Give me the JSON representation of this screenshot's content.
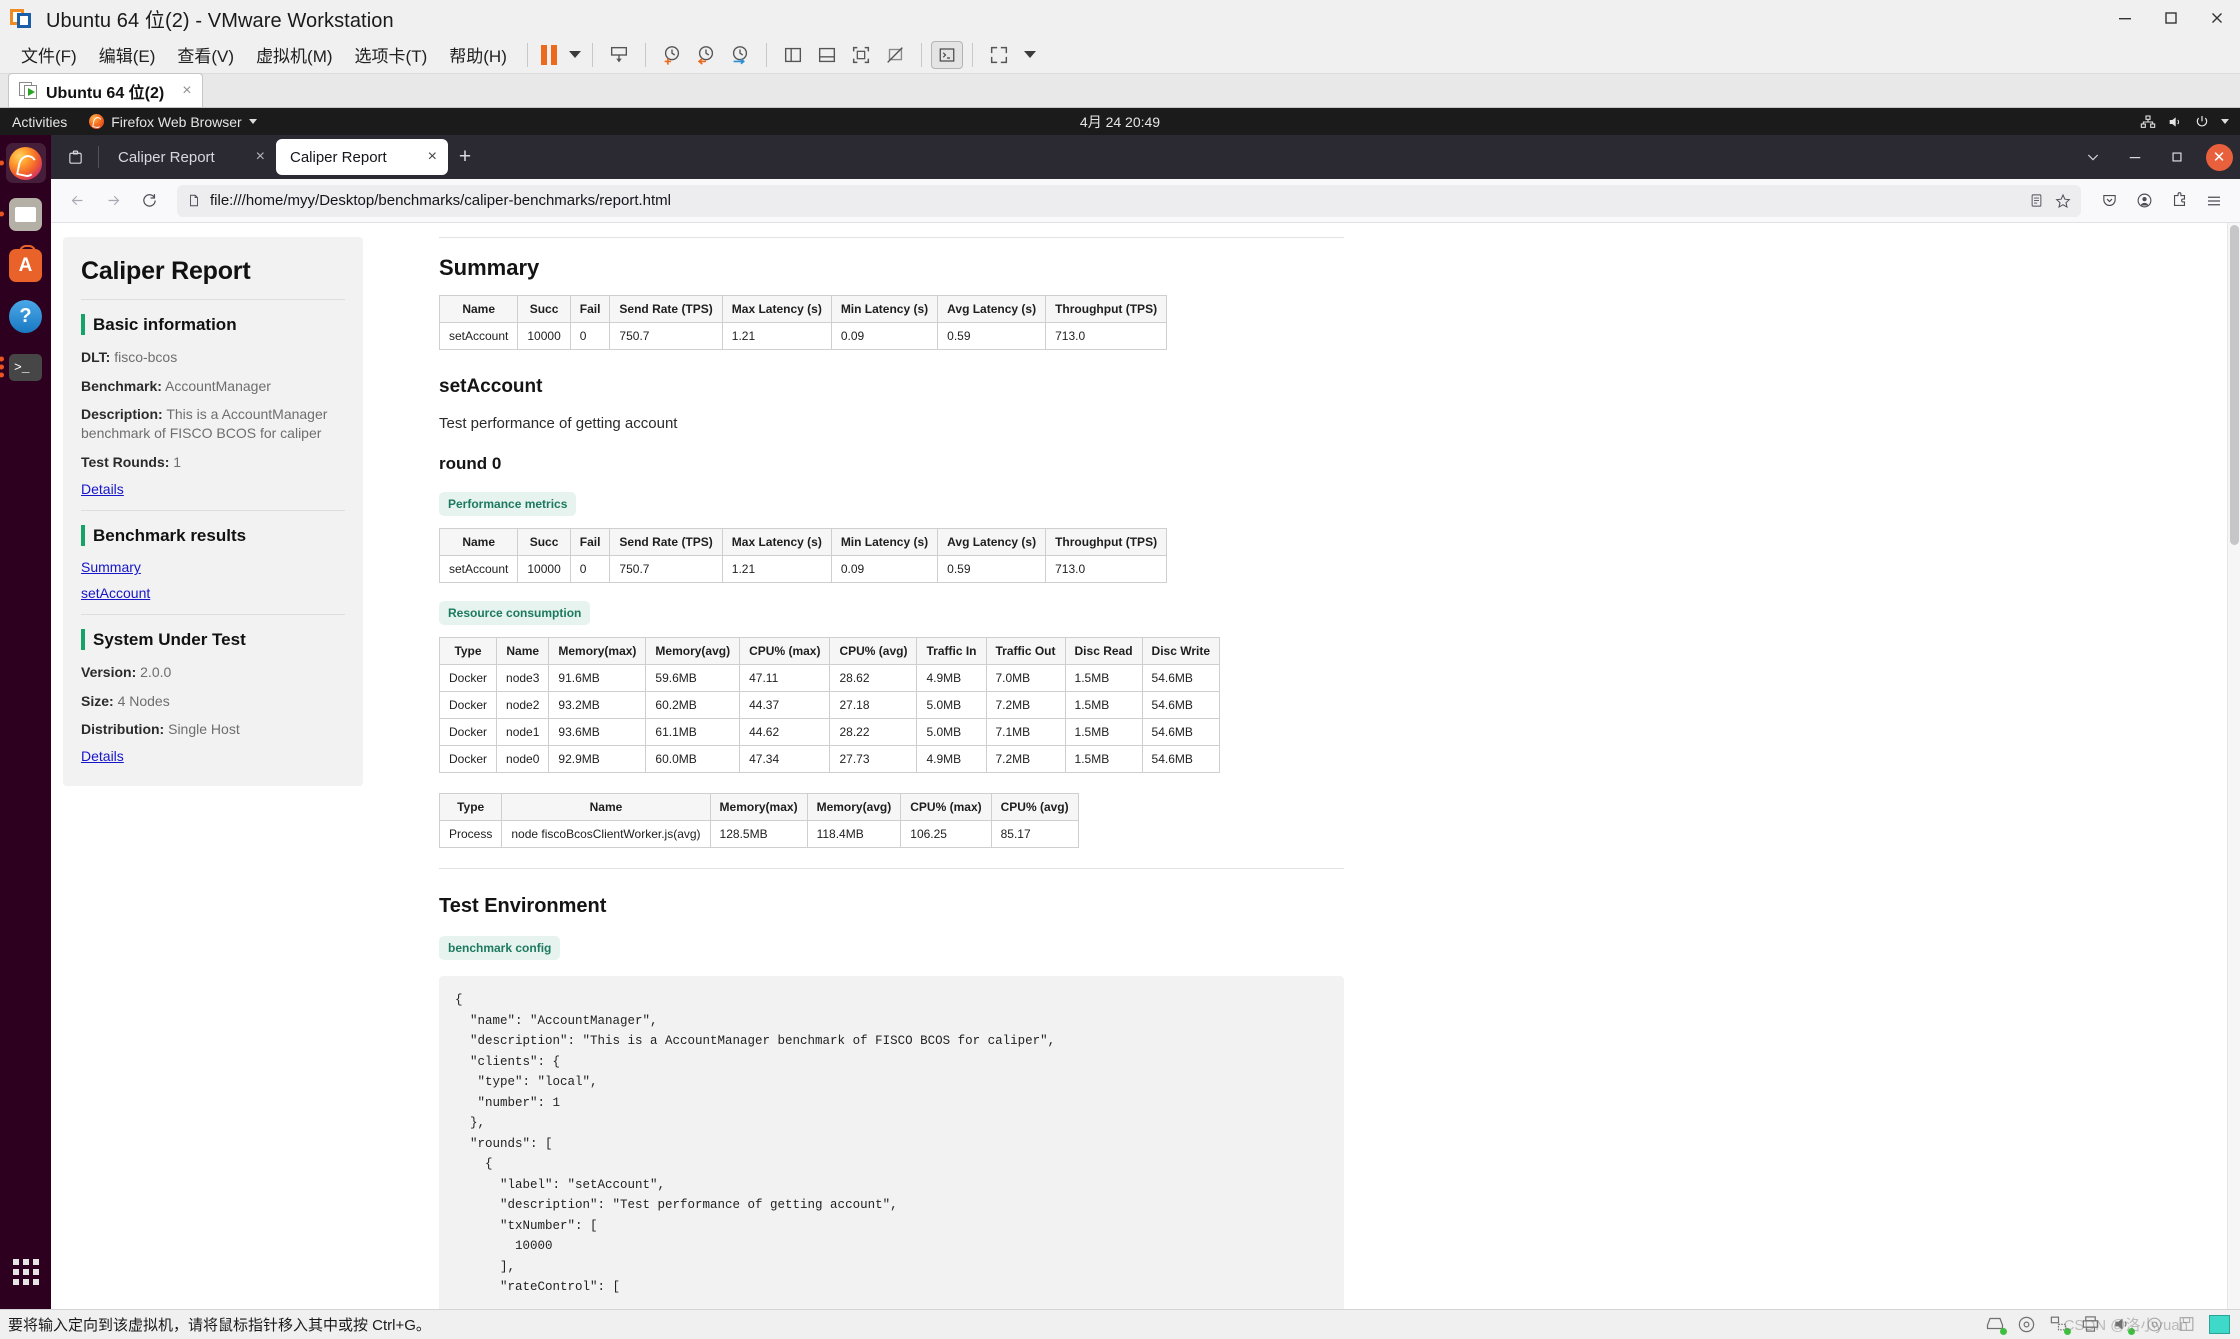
{
  "vmware": {
    "window_title": "Ubuntu 64 位(2) - VMware Workstation",
    "logo_icon": "vmware-logo-icon",
    "menus": [
      {
        "label": "文件(F)",
        "name": "menu-file"
      },
      {
        "label": "编辑(E)",
        "name": "menu-edit"
      },
      {
        "label": "查看(V)",
        "name": "menu-view"
      },
      {
        "label": "虚拟机(M)",
        "name": "menu-vm"
      },
      {
        "label": "选项卡(T)",
        "name": "menu-tabs"
      },
      {
        "label": "帮助(H)",
        "name": "menu-help"
      }
    ],
    "toolbar": [
      {
        "name": "suspend-button",
        "icon": "pause-icon"
      },
      {
        "name": "power-dropdown",
        "icon": "chevron-down-icon"
      },
      {
        "name": "send-ctrl-alt-del-button",
        "icon": "keyboard-send-icon"
      },
      {
        "name": "take-snapshot-button",
        "icon": "snapshot-add-icon"
      },
      {
        "name": "revert-snapshot-button",
        "icon": "snapshot-revert-icon"
      },
      {
        "name": "snapshot-manager-button",
        "icon": "snapshot-manager-icon"
      },
      {
        "name": "show-library-button",
        "icon": "panel-left-icon"
      },
      {
        "name": "show-thumbnail-bar-button",
        "icon": "panel-bottom-icon"
      },
      {
        "name": "full-screen-button",
        "icon": "fullscreen-icon"
      },
      {
        "name": "unity-mode-button",
        "icon": "unity-mode-icon"
      },
      {
        "name": "console-view-button",
        "icon": "terminal-icon"
      },
      {
        "name": "stretch-view-button",
        "icon": "stretch-icon"
      },
      {
        "name": "stretch-view-dropdown",
        "icon": "chevron-down-icon"
      }
    ],
    "vm_tab": {
      "label": "Ubuntu 64 位(2)",
      "icon": "vm-running-icon",
      "close": "×"
    },
    "window_controls": {
      "minimize": "minimize-icon",
      "maximize": "maximize-icon",
      "close": "close-icon"
    },
    "statusbar": {
      "message": "要将输入定向到该虚拟机，请将鼠标指针移入其中或按 Ctrl+G。",
      "devices": [
        "hard-disk-icon",
        "cd-dvd-icon",
        "network-adapter-icon",
        "printer-icon",
        "sound-card-icon",
        "usb-icon",
        "floppy-icon",
        "display-icon"
      ],
      "watermark": "CSDN @洛小yuan"
    }
  },
  "ubuntu": {
    "topbar": {
      "activities": "Activities",
      "app_name": "Firefox Web Browser",
      "app_icon": "firefox-icon",
      "clock": "4月 24  20:49",
      "system_icons": [
        "network-icon",
        "volume-icon",
        "power-icon",
        "chevron-down-icon"
      ]
    },
    "dock": [
      {
        "name": "dock-item-firefox",
        "icon": "firefox-icon",
        "running": true,
        "active": true
      },
      {
        "name": "dock-item-files",
        "icon": "files-icon",
        "running": true,
        "active": false
      },
      {
        "name": "dock-item-software",
        "icon": "ubuntu-software-icon",
        "running": false,
        "active": false
      },
      {
        "name": "dock-item-help",
        "icon": "help-icon",
        "running": false,
        "active": false
      },
      {
        "name": "dock-item-terminal",
        "icon": "terminal-icon",
        "running": true,
        "active": false
      }
    ],
    "show_apps": "show-applications-icon"
  },
  "firefox": {
    "list_all_tabs_icon": "list-all-tabs-icon",
    "tabs": [
      {
        "title": "Caliper Report",
        "selected": false,
        "close": "×"
      },
      {
        "title": "Caliper Report",
        "selected": true,
        "close": "×"
      }
    ],
    "new_tab": "+",
    "window_controls": {
      "minimize": "−",
      "restore": "▫",
      "close": "×"
    },
    "nav": {
      "back_icon": "arrow-left-icon",
      "forward_icon": "arrow-right-icon",
      "reload_icon": "reload-icon",
      "page_icon": "document-icon",
      "url": "file:///home/myy/Desktop/benchmarks/caliper-benchmarks/report.html",
      "reader_icon": "reader-mode-icon",
      "bookmark_icon": "star-icon"
    },
    "toolbar_right": [
      "pocket-icon",
      "account-icon",
      "extensions-icon",
      "hamburger-menu-icon"
    ]
  },
  "report": {
    "sidebar": {
      "title": "Caliper Report",
      "sections": [
        {
          "heading": "Basic information",
          "fields": [
            {
              "key": "DLT:",
              "value": "fisco-bcos"
            },
            {
              "key": "Benchmark:",
              "value": "AccountManager"
            },
            {
              "key": "Description:",
              "value": "This is a AccountManager benchmark of FISCO BCOS for caliper"
            },
            {
              "key": "Test Rounds:",
              "value": "1"
            }
          ],
          "link": "Details"
        },
        {
          "heading": "Benchmark results",
          "links": [
            "Summary",
            "setAccount"
          ]
        },
        {
          "heading": "System Under Test",
          "fields": [
            {
              "key": "Version:",
              "value": "2.0.0"
            },
            {
              "key": "Size:",
              "value": "4 Nodes"
            },
            {
              "key": "Distribution:",
              "value": "Single Host"
            }
          ],
          "link": "Details"
        }
      ]
    },
    "main": {
      "summary_heading": "Summary",
      "round_name": "setAccount",
      "round_description": "Test performance of getting account",
      "round_heading": "round 0",
      "pill_performance": "Performance metrics",
      "pill_resource": "Resource consumption",
      "env_heading": "Test Environment",
      "pill_config": "benchmark config",
      "perf_columns": [
        "Name",
        "Succ",
        "Fail",
        "Send Rate (TPS)",
        "Max Latency (s)",
        "Min Latency (s)",
        "Avg Latency (s)",
        "Throughput (TPS)"
      ],
      "summary_rows": [
        [
          "setAccount",
          "10000",
          "0",
          "750.7",
          "1.21",
          "0.09",
          "0.59",
          "713.0"
        ]
      ],
      "perf_rows": [
        [
          "setAccount",
          "10000",
          "0",
          "750.7",
          "1.21",
          "0.09",
          "0.59",
          "713.0"
        ]
      ],
      "resource_columns": [
        "Type",
        "Name",
        "Memory(max)",
        "Memory(avg)",
        "CPU% (max)",
        "CPU% (avg)",
        "Traffic In",
        "Traffic Out",
        "Disc Read",
        "Disc Write"
      ],
      "resource_rows": [
        [
          "Docker",
          "node3",
          "91.6MB",
          "59.6MB",
          "47.11",
          "28.62",
          "4.9MB",
          "7.0MB",
          "1.5MB",
          "54.6MB"
        ],
        [
          "Docker",
          "node2",
          "93.2MB",
          "60.2MB",
          "44.37",
          "27.18",
          "5.0MB",
          "7.2MB",
          "1.5MB",
          "54.6MB"
        ],
        [
          "Docker",
          "node1",
          "93.6MB",
          "61.1MB",
          "44.62",
          "28.22",
          "5.0MB",
          "7.1MB",
          "1.5MB",
          "54.6MB"
        ],
        [
          "Docker",
          "node0",
          "92.9MB",
          "60.0MB",
          "47.34",
          "27.73",
          "4.9MB",
          "7.2MB",
          "1.5MB",
          "54.6MB"
        ]
      ],
      "process_columns": [
        "Type",
        "Name",
        "Memory(max)",
        "Memory(avg)",
        "CPU% (max)",
        "CPU% (avg)"
      ],
      "process_rows": [
        [
          "Process",
          "node fiscoBcosClientWorker.js(avg)",
          "128.5MB",
          "118.4MB",
          "106.25",
          "85.17"
        ]
      ],
      "config_code": "{\n  \"name\": \"AccountManager\",\n  \"description\": \"This is a AccountManager benchmark of FISCO BCOS for caliper\",\n  \"clients\": {\n   \"type\": \"local\",\n   \"number\": 1\n  },\n  \"rounds\": [\n    {\n      \"label\": \"setAccount\",\n      \"description\": \"Test performance of getting account\",\n      \"txNumber\": [\n        10000\n      ],\n      \"rateControl\": ["
    }
  },
  "colors": {
    "accent_green": "#16a36a",
    "pill_bg": "#e6f3ee",
    "pill_text": "#1d7a5f",
    "link": "#1616c8",
    "firefox_orange": "#e8603c",
    "vmware_orange": "#ed6a1c"
  }
}
